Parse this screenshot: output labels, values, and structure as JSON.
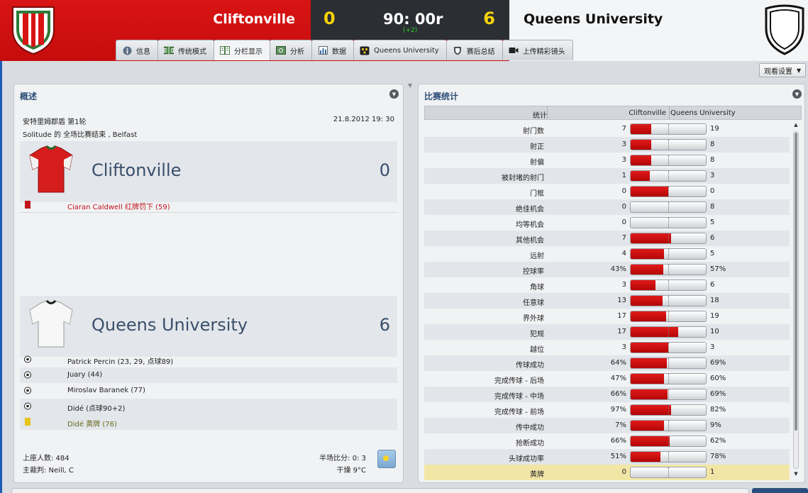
{
  "header": {
    "home_team": "Cliftonville",
    "away_team": "Queens University",
    "home_score": "0",
    "away_score": "6",
    "clock": "90: 00r",
    "added_time": "(+2)"
  },
  "tabs": [
    {
      "label": "信息",
      "icon": "info-icon"
    },
    {
      "label": "传统模式",
      "icon": "pitch-icon"
    },
    {
      "label": "分栏显示",
      "icon": "split-view-icon"
    },
    {
      "label": "分析",
      "icon": "analysis-icon"
    },
    {
      "label": "数据",
      "icon": "bar-chart-icon"
    },
    {
      "label": "Queens University",
      "icon": "opponent-icon"
    },
    {
      "label": "赛后总结",
      "icon": "shield-icon"
    },
    {
      "label": "上传精彩镜头",
      "icon": "camera-icon"
    }
  ],
  "active_tab": "分栏显示",
  "view_settings_label": "观看设置",
  "overview": {
    "title": "概述",
    "competition": "安特里姆郡盾 第1轮",
    "venue": "Solitude 的 全场比赛结束 , Belfast",
    "date": "21.8.2012 19: 30",
    "home": {
      "name": "Cliftonville",
      "score": "0",
      "events": [
        {
          "type": "red-card",
          "text": "Ciaran Caldwell 红牌罚下 (59)"
        }
      ]
    },
    "away": {
      "name": "Queens University",
      "score": "6",
      "events": [
        {
          "type": "goal",
          "text": "Patrick Percin (23, 29, 点球89)"
        },
        {
          "type": "goal",
          "text": "Juary (44)"
        },
        {
          "type": "goal",
          "text": "Miroslav Baranek (77)"
        },
        {
          "type": "goal",
          "text": "Didé (点球90+2)"
        },
        {
          "type": "yellow-card",
          "text": "Didé 黄牌 (76)"
        }
      ]
    },
    "attendance": "上座人数: 484",
    "referee": "主裁判: Neill, C",
    "half_time": "半场比分: 0: 3",
    "weather": "干燥 9°C"
  },
  "stats": {
    "title": "比赛统计",
    "col_stat": "统计",
    "col_home": "Cliftonville",
    "col_away": "Queens University",
    "rows": [
      {
        "name": "射门数",
        "home": "7",
        "away": "19",
        "share": 0.27
      },
      {
        "name": "射正",
        "home": "3",
        "away": "8",
        "share": 0.27
      },
      {
        "name": "射偏",
        "home": "3",
        "away": "8",
        "share": 0.27
      },
      {
        "name": "被封堵的射门",
        "home": "1",
        "away": "3",
        "share": 0.25
      },
      {
        "name": "门框",
        "home": "0",
        "away": "0",
        "share": 0.5
      },
      {
        "name": "绝佳机会",
        "home": "0",
        "away": "8",
        "share": 0.0
      },
      {
        "name": "均等机会",
        "home": "0",
        "away": "5",
        "share": 0.0
      },
      {
        "name": "其他机会",
        "home": "7",
        "away": "6",
        "share": 0.54
      },
      {
        "name": "远射",
        "home": "4",
        "away": "5",
        "share": 0.44
      },
      {
        "name": "控球率",
        "home": "43%",
        "away": "57%",
        "share": 0.43
      },
      {
        "name": "角球",
        "home": "3",
        "away": "6",
        "share": 0.33
      },
      {
        "name": "任意球",
        "home": "13",
        "away": "18",
        "share": 0.42
      },
      {
        "name": "界外球",
        "home": "17",
        "away": "19",
        "share": 0.47
      },
      {
        "name": "犯规",
        "home": "17",
        "away": "10",
        "share": 0.63
      },
      {
        "name": "越位",
        "home": "3",
        "away": "3",
        "share": 0.5
      },
      {
        "name": "传球成功",
        "home": "64%",
        "away": "69%",
        "share": 0.48
      },
      {
        "name": "完成传球 - 后场",
        "home": "47%",
        "away": "60%",
        "share": 0.44
      },
      {
        "name": "完成传球 - 中场",
        "home": "66%",
        "away": "69%",
        "share": 0.49
      },
      {
        "name": "完成传球 - 前场",
        "home": "97%",
        "away": "82%",
        "share": 0.54
      },
      {
        "name": "传中成功",
        "home": "7%",
        "away": "9%",
        "share": 0.44
      },
      {
        "name": "抢断成功",
        "home": "66%",
        "away": "62%",
        "share": 0.52
      },
      {
        "name": "头球成功率",
        "home": "51%",
        "away": "78%",
        "share": 0.4
      },
      {
        "name": "黄牌",
        "home": "0",
        "away": "1",
        "share": 0.0,
        "highlight": true
      }
    ]
  },
  "colors": {
    "home": "#c60c0c",
    "score": "#f5d20a",
    "added_time": "#2bd12b",
    "title": "#2e4f7a"
  }
}
